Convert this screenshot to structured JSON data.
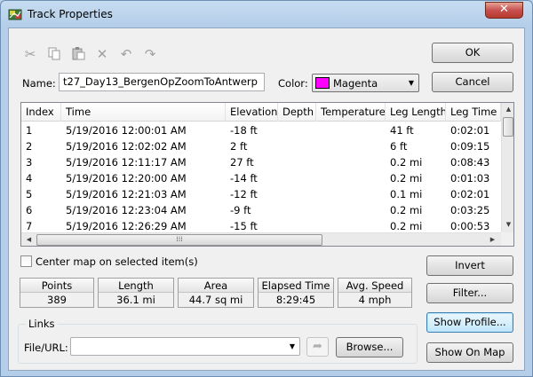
{
  "window": {
    "title": "Track Properties",
    "close_symbol": "✕"
  },
  "toolbar": {
    "icons": [
      "cut-icon",
      "copy-icon",
      "paste-icon",
      "delete-icon",
      "undo-icon",
      "redo-icon"
    ]
  },
  "buttons": {
    "ok": "OK",
    "cancel": "Cancel",
    "invert": "Invert",
    "filter": "Filter...",
    "show_profile": "Show Profile...",
    "show_on_map": "Show On Map",
    "browse": "Browse..."
  },
  "name_field": {
    "label": "Name:",
    "value": "t27_Day13_BergenOpZoomToAntwerp"
  },
  "color_field": {
    "label": "Color:",
    "value": "Magenta",
    "swatch": "#ff00ff"
  },
  "table": {
    "columns": [
      "Index",
      "Time",
      "Elevation",
      "Depth",
      "Temperature",
      "Leg Length",
      "Leg Time"
    ],
    "rows": [
      [
        "1",
        "5/19/2016 12:00:01 AM",
        "-18 ft",
        "",
        "",
        "41 ft",
        "0:02:01"
      ],
      [
        "2",
        "5/19/2016 12:02:02 AM",
        "2 ft",
        "",
        "",
        "6 ft",
        "0:09:15"
      ],
      [
        "3",
        "5/19/2016 12:11:17 AM",
        "27 ft",
        "",
        "",
        "0.2 mi",
        "0:08:43"
      ],
      [
        "4",
        "5/19/2016 12:20:00 AM",
        "-14 ft",
        "",
        "",
        "0.2 mi",
        "0:01:03"
      ],
      [
        "5",
        "5/19/2016 12:21:03 AM",
        "-12 ft",
        "",
        "",
        "0.1 mi",
        "0:02:01"
      ],
      [
        "6",
        "5/19/2016 12:23:04 AM",
        "-9 ft",
        "",
        "",
        "0.2 mi",
        "0:03:25"
      ],
      [
        "7",
        "5/19/2016 12:26:29 AM",
        "-15 ft",
        "",
        "",
        "0.2 mi",
        "0:00:53"
      ]
    ]
  },
  "center_map": {
    "label": "Center map on selected item(s)",
    "checked": false
  },
  "stats": [
    {
      "label": "Points",
      "value": "389"
    },
    {
      "label": "Length",
      "value": "36.1 mi"
    },
    {
      "label": "Area",
      "value": "44.7 sq mi"
    },
    {
      "label": "Elapsed Time",
      "value": "8:29:45"
    },
    {
      "label": "Avg. Speed",
      "value": "4 mph"
    }
  ],
  "links": {
    "group_title": "Links",
    "field_label": "File/URL:",
    "value": ""
  }
}
